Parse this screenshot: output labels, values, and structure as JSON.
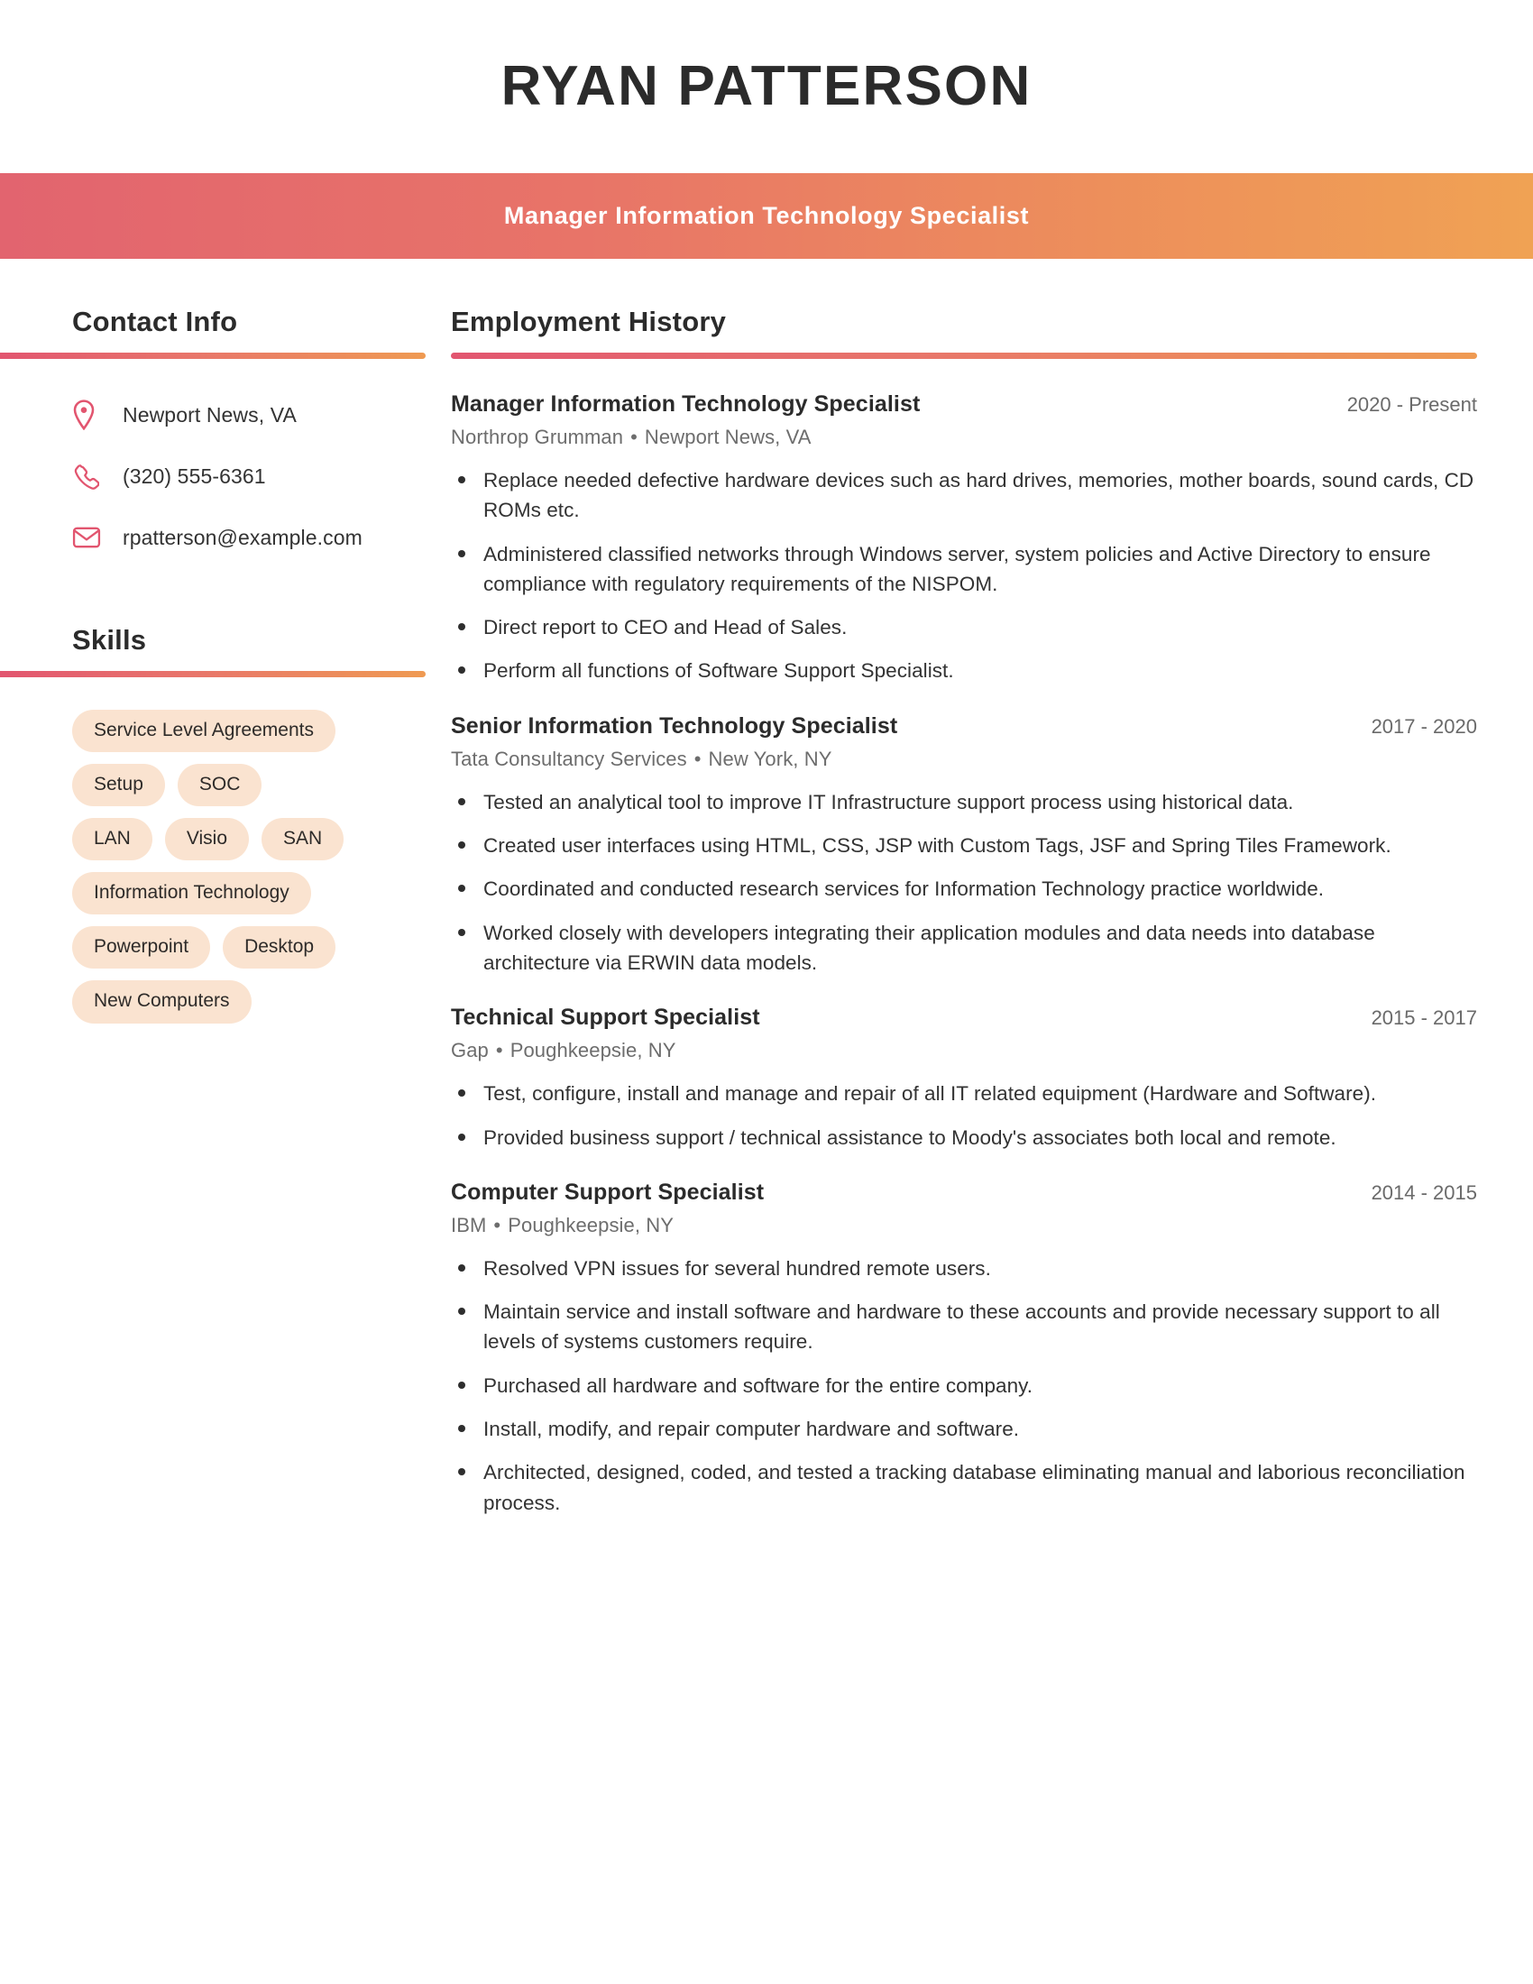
{
  "header": {
    "name": "RYAN PATTERSON",
    "title": "Manager Information Technology Specialist",
    "banner_gradient_start": "#e2646f",
    "banner_gradient_end": "#f0a254"
  },
  "theme": {
    "accent_start": "#e2556f",
    "accent_end": "#ef9a52",
    "chip_bg": "#fae3d0",
    "text_dark": "#2b2b2b",
    "text_muted": "#6d6d6d"
  },
  "sidebar": {
    "contact": {
      "heading": "Contact Info",
      "items": [
        {
          "icon": "location-pin-icon",
          "value": "Newport News, VA"
        },
        {
          "icon": "phone-icon",
          "value": "(320) 555-6361"
        },
        {
          "icon": "envelope-icon",
          "value": "rpatterson@example.com"
        }
      ]
    },
    "skills": {
      "heading": "Skills",
      "items": [
        "Service Level Agreements",
        "Setup",
        "SOC",
        "LAN",
        "Visio",
        "SAN",
        "Information Technology",
        "Powerpoint",
        "Desktop",
        "New Computers"
      ]
    }
  },
  "main": {
    "employment": {
      "heading": "Employment History",
      "jobs": [
        {
          "title": "Manager Information Technology Specialist",
          "dates": "2020 - Present",
          "company": "Northrop Grumman",
          "location": "Newport News, VA",
          "bullets": [
            "Replace needed defective hardware devices such as hard drives, memories, mother boards, sound cards, CD ROMs etc.",
            "Administered classified networks through Windows server, system policies and Active Directory to ensure compliance with regulatory requirements of the NISPOM.",
            "Direct report to CEO and Head of Sales.",
            "Perform all functions of Software Support Specialist."
          ]
        },
        {
          "title": "Senior Information Technology Specialist",
          "dates": "2017 - 2020",
          "company": "Tata Consultancy Services",
          "location": "New York, NY",
          "bullets": [
            "Tested an analytical tool to improve IT Infrastructure support process using historical data.",
            "Created user interfaces using HTML, CSS, JSP with Custom Tags, JSF and Spring Tiles Framework.",
            "Coordinated and conducted research services for Information Technology practice worldwide.",
            "Worked closely with developers integrating their application modules and data needs into database architecture via ERWIN data models."
          ]
        },
        {
          "title": "Technical Support Specialist",
          "dates": "2015 - 2017",
          "company": "Gap",
          "location": "Poughkeepsie, NY",
          "bullets": [
            "Test, configure, install and manage and repair of all IT related equipment (Hardware and Software).",
            "Provided business support / technical assistance to Moody's associates both local and remote."
          ]
        },
        {
          "title": "Computer Support Specialist",
          "dates": "2014 - 2015",
          "company": "IBM",
          "location": "Poughkeepsie, NY",
          "bullets": [
            "Resolved VPN issues for several hundred remote users.",
            "Maintain service and install software and hardware to these accounts and provide necessary support to all levels of systems customers require.",
            "Purchased all hardware and software for the entire company.",
            "Install, modify, and repair computer hardware and software.",
            "Architected, designed, coded, and tested a tracking database eliminating manual and laborious reconciliation process."
          ]
        }
      ]
    }
  }
}
